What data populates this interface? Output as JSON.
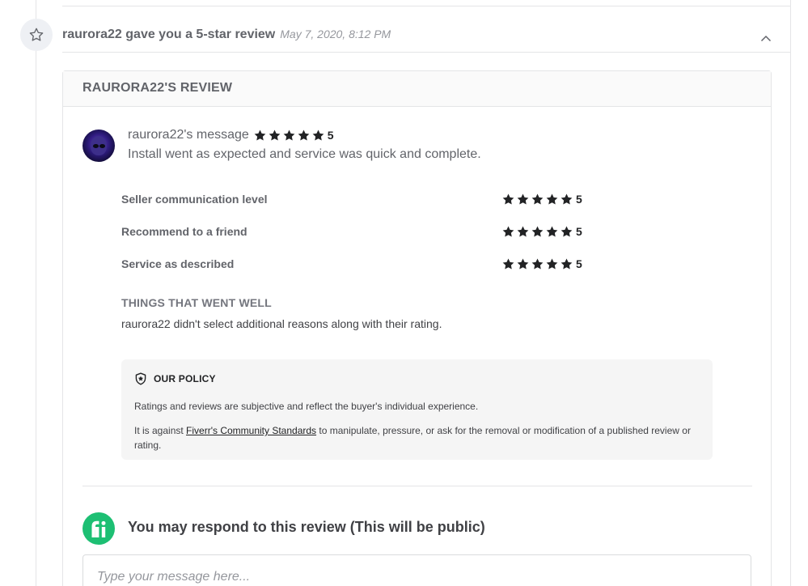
{
  "event": {
    "title": "raurora22 gave you a 5-star review",
    "date": "May 7, 2020, 8:12 PM"
  },
  "review": {
    "header": "RAURORA22'S REVIEW",
    "author_message_label": "raurora22's message",
    "overall_rating": "5",
    "overall_rating_value": 5,
    "message": "Install went as expected and service was quick and complete.",
    "ratings": [
      {
        "label": "Seller communication level",
        "value": "5"
      },
      {
        "label": "Recommend to a friend",
        "value": "5"
      },
      {
        "label": "Service as described",
        "value": "5"
      }
    ],
    "things_went_well_title": "THINGS THAT WENT WELL",
    "things_went_well_text": "raurora22 didn't select additional reasons along with their rating."
  },
  "policy": {
    "title": "OUR POLICY",
    "paragraph1": "Ratings and reviews are subjective and reflect the buyer's individual experience.",
    "paragraph2_before": "It is against ",
    "paragraph2_link": "Fiverr's Community Standards",
    "paragraph2_after": " to manipulate, pressure, or ask for the removal or modification of a published review or rating."
  },
  "respond": {
    "title": "You may respond to this review (This will be public)",
    "placeholder": "Type your message here..."
  },
  "icons": {
    "event": "star-outline-icon",
    "collapse": "chevron-up-icon",
    "star": "star-filled-icon",
    "policy": "shield-star-icon",
    "logo": "fiverr-logo-icon"
  },
  "colors": {
    "brand_green": "#1dbf73",
    "star": "#222325",
    "text": "#404145"
  }
}
